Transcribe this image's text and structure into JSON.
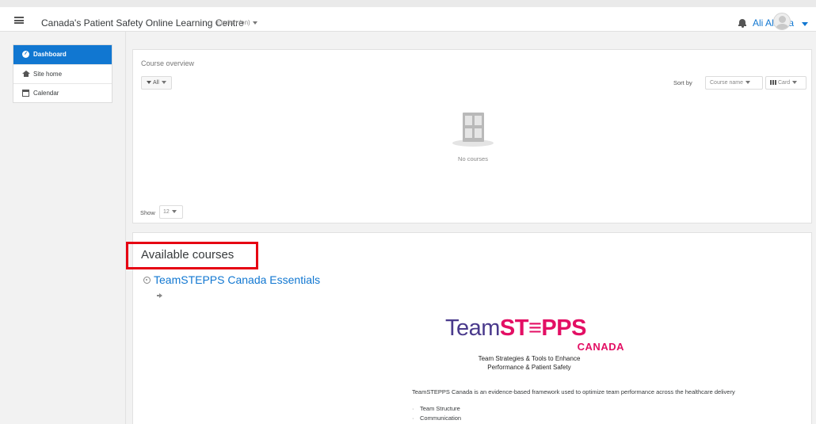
{
  "header": {
    "site_title": "Canada's Patient Safety Online Learning Centre",
    "language": "English (en)",
    "username": "Ali Alidina"
  },
  "sidebar": {
    "items": [
      {
        "label": "Dashboard",
        "icon": "dashboard-icon",
        "active": true
      },
      {
        "label": "Site home",
        "icon": "home-icon",
        "active": false
      },
      {
        "label": "Calendar",
        "icon": "calendar-icon",
        "active": false
      }
    ]
  },
  "course_overview": {
    "title": "Course overview",
    "filter_label": "All",
    "sort_by_label": "Sort by",
    "sort_value": "Course name",
    "view_value": "Card",
    "empty_message": "No courses",
    "show_label": "Show",
    "show_value": "12"
  },
  "available_courses": {
    "heading": "Available courses",
    "course_name": "TeamSTEPPS Canada Essentials",
    "logo": {
      "team": "Team",
      "stepps": "ST≡PPS",
      "canada": "CANADA"
    },
    "tagline_line1": "Team Strategies & Tools to Enhance",
    "tagline_line2": "Performance & Patient Safety",
    "description": "TeamSTEPPS Canada is an evidence-based framework used to optimize team performance across the healthcare delivery",
    "bullets": [
      "Team Structure",
      "Communication"
    ]
  },
  "colors": {
    "accent": "#1177d1",
    "highlight": "#e60012",
    "logo_purple": "#4a3a8c",
    "logo_pink": "#e30f64"
  }
}
